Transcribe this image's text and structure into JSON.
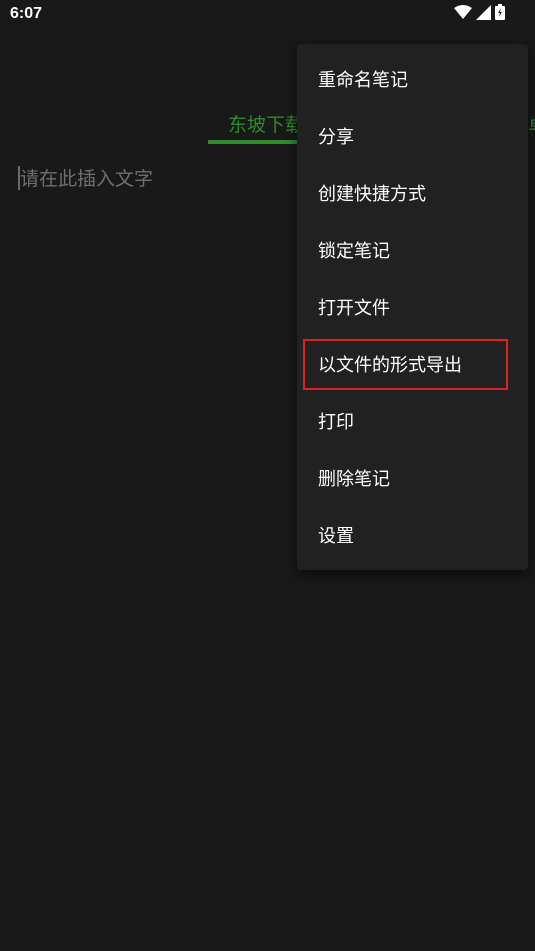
{
  "status_bar": {
    "time": "6:07",
    "icons": [
      "wifi-icon",
      "signal-icon",
      "battery-icon"
    ]
  },
  "tabs": {
    "active_label": "东坡下载",
    "next_label": "卓"
  },
  "editor": {
    "placeholder": "请在此插入文字"
  },
  "menu": {
    "items": [
      {
        "label": "重命名笔记"
      },
      {
        "label": "分享"
      },
      {
        "label": "创建快捷方式"
      },
      {
        "label": "锁定笔记"
      },
      {
        "label": "打开文件"
      },
      {
        "label": "以文件的形式导出"
      },
      {
        "label": "打印"
      },
      {
        "label": "删除笔记"
      },
      {
        "label": "设置"
      }
    ],
    "highlighted_item": "以文件的形式导出"
  },
  "colors": {
    "background": "#191919",
    "menu_background": "#212121",
    "accent_green": "#2e8b2e",
    "highlight_red": "#e02020"
  }
}
